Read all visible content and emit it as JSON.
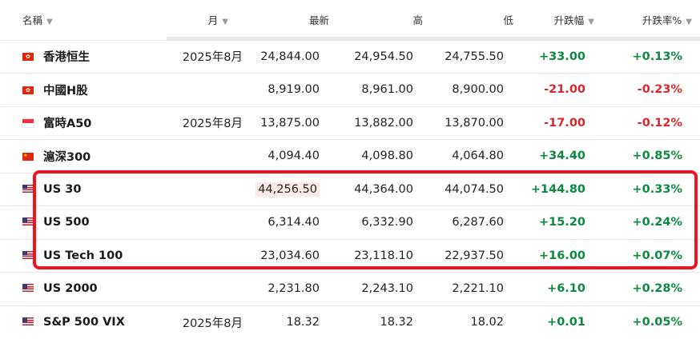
{
  "columns": {
    "name": "名稱",
    "month": "月",
    "last": "最新",
    "high": "高",
    "low": "低",
    "change": "升跌幅",
    "change_pct": "升跌率%"
  },
  "sort_icon": "▼",
  "colors": {
    "positive": "#0b8a3f",
    "negative": "#d9262d",
    "highlight_border": "#f0131e"
  },
  "rows": [
    {
      "flag": "hk-flag-icon",
      "name": "香港恒生",
      "month": "2025年8月",
      "last": "24,844.00",
      "high": "24,954.50",
      "low": "24,755.50",
      "change": "+33.00",
      "change_pct": "+0.13%",
      "direction": "pos"
    },
    {
      "flag": "hk-flag-icon",
      "name": "中國H股",
      "month": "",
      "last": "8,919.00",
      "high": "8,961.00",
      "low": "8,900.00",
      "change": "-21.00",
      "change_pct": "-0.23%",
      "direction": "neg"
    },
    {
      "flag": "sg-flag-icon",
      "name": "富時A50",
      "month": "2025年8月",
      "last": "13,875.00",
      "high": "13,882.00",
      "low": "13,870.00",
      "change": "-17.00",
      "change_pct": "-0.12%",
      "direction": "neg"
    },
    {
      "flag": "cn-flag-icon",
      "name": "滬深300",
      "month": "",
      "last": "4,094.40",
      "high": "4,098.80",
      "low": "4,064.80",
      "change": "+34.40",
      "change_pct": "+0.85%",
      "direction": "pos"
    },
    {
      "flag": "us-flag-icon",
      "name": "US 30",
      "month": "",
      "last": "44,256.50",
      "high": "44,364.00",
      "low": "44,074.50",
      "change": "+144.80",
      "change_pct": "+0.33%",
      "direction": "pos"
    },
    {
      "flag": "us-flag-icon",
      "name": "US 500",
      "month": "",
      "last": "6,314.40",
      "high": "6,332.90",
      "low": "6,287.60",
      "change": "+15.20",
      "change_pct": "+0.24%",
      "direction": "pos"
    },
    {
      "flag": "us-flag-icon",
      "name": "US Tech 100",
      "month": "",
      "last": "23,034.60",
      "high": "23,118.10",
      "low": "22,937.50",
      "change": "+16.00",
      "change_pct": "+0.07%",
      "direction": "pos"
    },
    {
      "flag": "us-flag-icon",
      "name": "US 2000",
      "month": "",
      "last": "2,231.80",
      "high": "2,243.10",
      "low": "2,221.10",
      "change": "+6.10",
      "change_pct": "+0.28%",
      "direction": "pos"
    },
    {
      "flag": "us-flag-icon",
      "name": "S&P 500 VIX",
      "month": "2025年8月",
      "last": "18.32",
      "high": "18.32",
      "low": "18.02",
      "change": "+0.01",
      "change_pct": "+0.05%",
      "direction": "pos"
    }
  ]
}
